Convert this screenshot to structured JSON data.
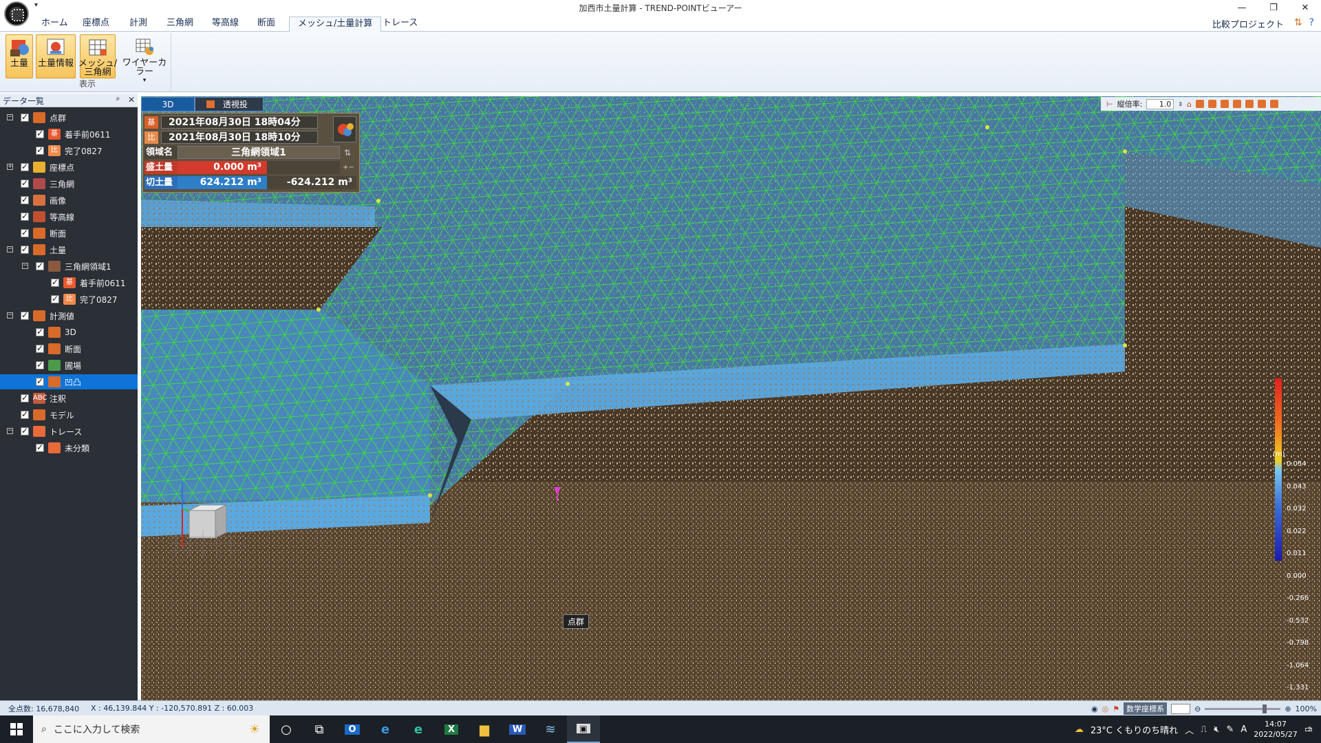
{
  "window": {
    "title": "加西市土量計算 - TREND-POINTビューアー",
    "controls": [
      "—",
      "❐",
      "✕"
    ]
  },
  "ribbon_tabs": [
    "ホーム",
    "座標点",
    "計測",
    "三角網",
    "等高線",
    "断面",
    "メッシュ/土量計算",
    "トレース"
  ],
  "active_tab": "メッシュ/土量計算",
  "compare_project": "比較プロジェクト",
  "ribbon": {
    "group_label": "表示",
    "buttons": [
      {
        "label": "土量",
        "active": true,
        "icon": "soil-volume-icon"
      },
      {
        "label": "土量情報",
        "active": true,
        "icon": "soil-info-icon"
      },
      {
        "label": "メッシュ/\n三角網",
        "active": true,
        "icon": "mesh-grid-icon"
      },
      {
        "label": "ワイヤーカラー",
        "active": false,
        "icon": "wire-color-icon"
      }
    ]
  },
  "data_panel": {
    "title": "データ一覧",
    "pin": "ᵖ",
    "close": "✕",
    "tree": [
      {
        "label": "点群",
        "level": 0,
        "expand": "−",
        "color": "#d86a2a"
      },
      {
        "label": "着手前0611",
        "level": 1,
        "color": "#e8582e",
        "mark": "基"
      },
      {
        "label": "完了0827",
        "level": 1,
        "color": "#f08a4a",
        "mark": "比"
      },
      {
        "label": "座標点",
        "level": 0,
        "expand": "+",
        "color": "#e8b030"
      },
      {
        "label": "三角網",
        "level": 0,
        "color": "#b04a4a"
      },
      {
        "label": "画像",
        "level": 0,
        "color": "#d87040"
      },
      {
        "label": "等高線",
        "level": 0,
        "color": "#c05030"
      },
      {
        "label": "断面",
        "level": 0,
        "color": "#d86a2a"
      },
      {
        "label": "土量",
        "level": 0,
        "expand": "−",
        "color": "#d86a2a"
      },
      {
        "label": "三角網領域1",
        "level": 1,
        "expand": "−",
        "color": "#8a5a40"
      },
      {
        "label": "着手前0611",
        "level": 2,
        "color": "#e8582e",
        "mark": "基"
      },
      {
        "label": "完了0827",
        "level": 2,
        "color": "#f08a4a",
        "mark": "比"
      },
      {
        "label": "計測値",
        "level": 0,
        "expand": "−",
        "color": "#d86a2a"
      },
      {
        "label": "3D",
        "level": 1,
        "color": "#d86a2a"
      },
      {
        "label": "断面",
        "level": 1,
        "color": "#d86a2a"
      },
      {
        "label": "圃場",
        "level": 1,
        "color": "#4a9a4a"
      },
      {
        "label": "凹凸",
        "level": 1,
        "color": "#d86a2a",
        "selected": true
      },
      {
        "label": "注釈",
        "level": 0,
        "color": "#c05a40",
        "mark": "ABC"
      },
      {
        "label": "モデル",
        "level": 0,
        "color": "#d86a2a"
      },
      {
        "label": "トレース",
        "level": 0,
        "expand": "−",
        "color": "#e86a3a"
      },
      {
        "label": "未分類",
        "level": 1,
        "color": "#e86a3a"
      }
    ]
  },
  "view": {
    "tabs": [
      "3D",
      "透視投影"
    ],
    "vertical_scale_label": "縦倍率:",
    "vertical_scale": "1.0",
    "tooltip": "点群"
  },
  "volume_info": {
    "base_mark": "基",
    "base_date": "2021年08月30日 18時04分",
    "compare_mark": "比",
    "compare_date": "2021年08月30日 18時10分",
    "region_label": "領域名",
    "region_name": "三角網領域1",
    "fill_label": "盛土量",
    "fill_value": "0.000 m³",
    "cut_label": "切土量",
    "cut_value": "624.212 m³",
    "net_value": "-624.212 m³"
  },
  "legend": {
    "unit": "(m)",
    "ticks": [
      "0.054",
      "0.043",
      "0.032",
      "0.022",
      "0.011",
      "0.000",
      "-0.266",
      "-0.532",
      "-0.798",
      "-1.064",
      "-1.331"
    ]
  },
  "status": {
    "total_points": "全点数: 16,678,840",
    "coords": "X : 46,139.844  Y : -120,570.891  Z : 60.003",
    "coord_system": "数学座標系",
    "zoom": "100%"
  },
  "taskbar": {
    "search_placeholder": "ここに入力して検索",
    "weather": "23°C  くもりのち晴れ",
    "ime": "A",
    "time": "14:07",
    "date": "2022/05/27",
    "notifications": "2"
  }
}
